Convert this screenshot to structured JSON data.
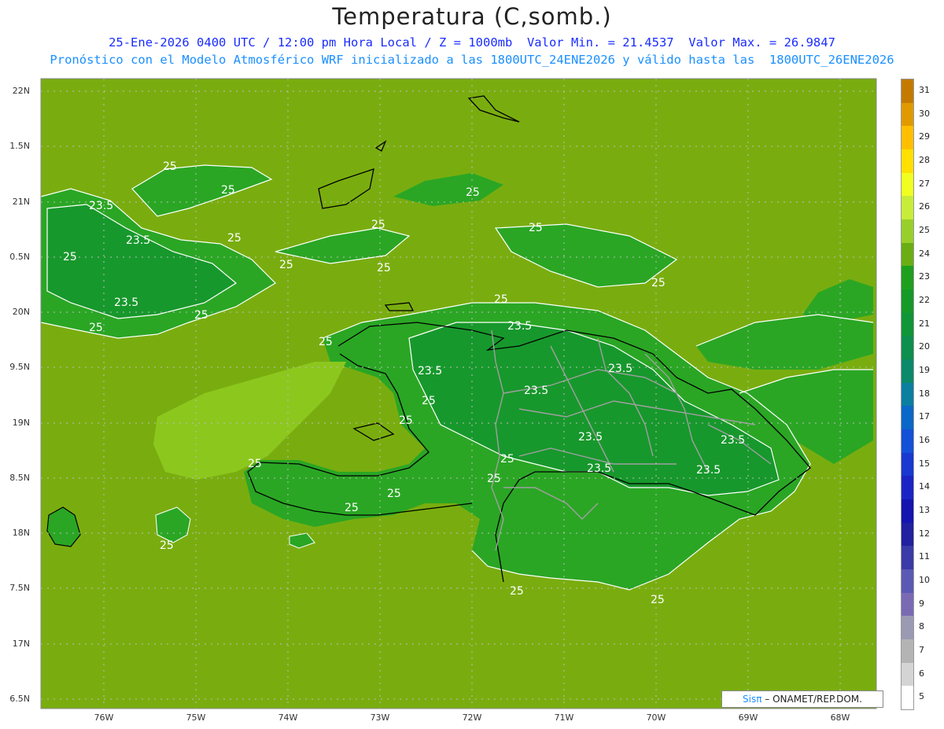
{
  "title": "Temperatura (C,somb.)",
  "subtitle_line1": "25-Ene-2026 0400 UTC / 12:00 pm Hora Local / Z = 1000mb  Valor Min. = 21.4537  Valor Max. = 26.9847",
  "subtitle_line2": "Pronóstico con el Modelo Atmosférico WRF inicializado a las 1800UTC_24ENE2026 y válido hasta las  1800UTC_26ENE2026",
  "lat_labels": [
    "22N",
    "1.5N",
    "21N",
    "0.5N",
    "20N",
    "9.5N",
    "19N",
    "8.5N",
    "18N",
    "7.5N",
    "17N",
    "6.5N"
  ],
  "lon_labels": [
    "76W",
    "75W",
    "74W",
    "73W",
    "72W",
    "71W",
    "70W",
    "69W",
    "68W"
  ],
  "colorbar": {
    "labels": [
      "31",
      "30",
      "29",
      "28",
      "27",
      "26",
      "25",
      "24",
      "23",
      "22",
      "21",
      "20",
      "19",
      "18",
      "17",
      "16",
      "15",
      "14",
      "13",
      "12",
      "11",
      "10",
      "9",
      "8",
      "7",
      "6",
      "5"
    ],
    "colors": [
      "#c47a00",
      "#e09a00",
      "#ffbf00",
      "#ffe000",
      "#f0ff20",
      "#c8ec3a",
      "#98cf2a",
      "#6aae14",
      "#1ea01e",
      "#159a28",
      "#0f9636",
      "#0d8f4e",
      "#0a8a6a",
      "#0a7fa0",
      "#0a68c8",
      "#1450d8",
      "#1838d0",
      "#1a24c4",
      "#1414b0",
      "#2020a0",
      "#3a3aa8",
      "#5a5ab4",
      "#7a6ab4",
      "#9a9ab4",
      "#b4b4b4",
      "#d4d4d4",
      "#ffffff"
    ]
  },
  "contour_labels": [
    "25",
    "25",
    "23.5",
    "23.5",
    "25",
    "25",
    "25",
    "23.5",
    "25",
    "25",
    "23.5",
    "25",
    "25",
    "25",
    "25",
    "23.5",
    "23.5",
    "23.5",
    "25",
    "25",
    "25",
    "23.5",
    "25",
    "23.5",
    "25",
    "25",
    "25",
    "23.5",
    "23.5",
    "25",
    "25",
    "25",
    "25",
    "25",
    "25"
  ],
  "credit": {
    "brand": "Sisπ",
    "text": " – ONAMET/REP.DOM."
  },
  "colors": {
    "sea": "#79ad0f",
    "land_warm": "#2aa624",
    "land_cool": "#17982c",
    "contour": "#ffffff",
    "coast": "#000000",
    "border": "#9a9a9a"
  }
}
